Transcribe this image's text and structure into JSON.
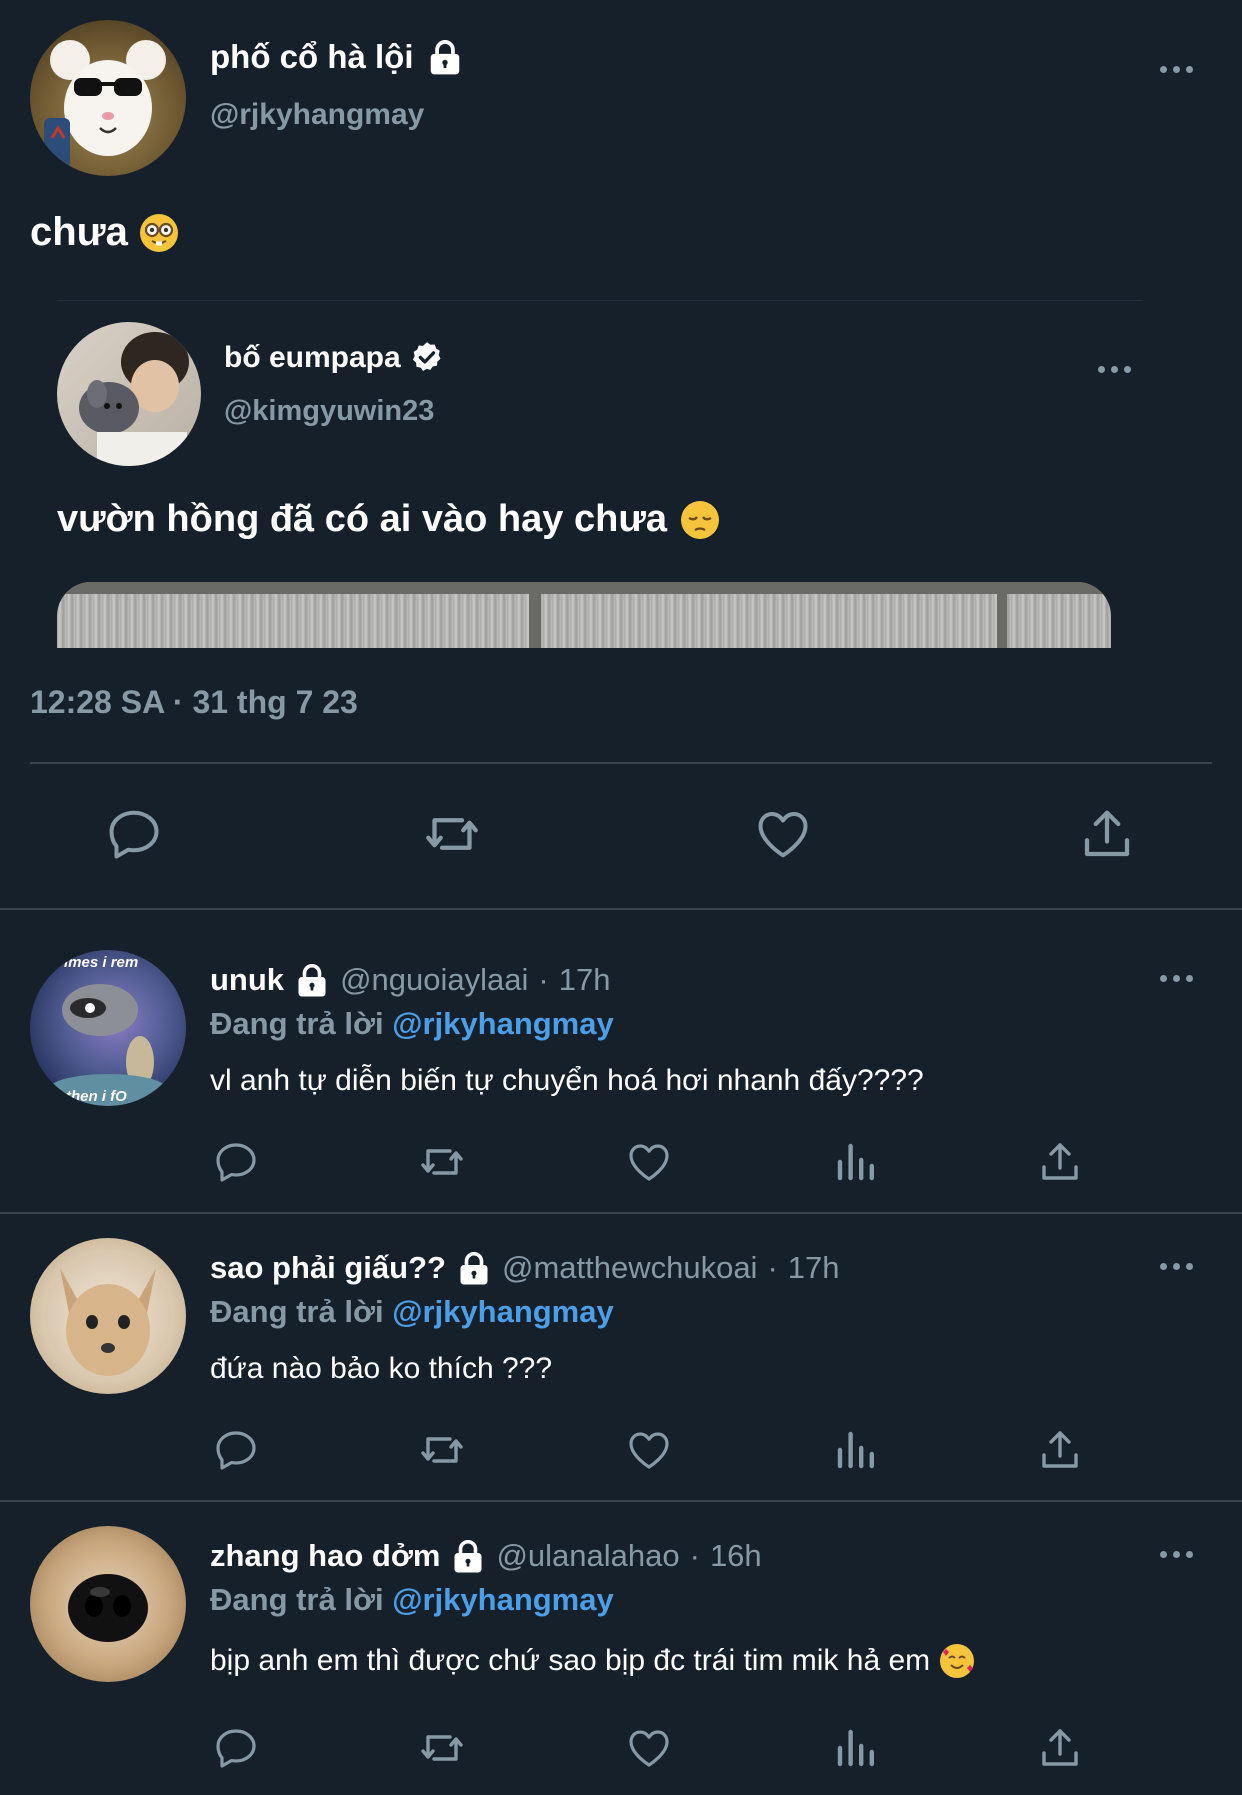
{
  "colors": {
    "background": "#15202b",
    "secondary_text": "#8899a6",
    "mention": "#4a9fe8",
    "divider": "#38444d"
  },
  "main_tweet": {
    "author_name": "phố cổ hà lội",
    "author_handle": "@rjkyhangmay",
    "text": "chưa",
    "timestamp": "12:28 SA · 31 thg 7 23",
    "icons": [
      "lock-icon",
      "more-icon",
      "nerd-face-emoji"
    ]
  },
  "quoted_tweet": {
    "author_name": "bố eumpapa",
    "author_handle": "@kimgyuwin23",
    "text": "vườn hồng đã có ai vào hay chưa",
    "icons": [
      "verified-icon",
      "pensive-face-emoji",
      "more-icon"
    ]
  },
  "main_actions": [
    "reply-icon",
    "retweet-icon",
    "like-icon",
    "share-icon"
  ],
  "replies": [
    {
      "name": "unuk",
      "handle": "@nguoiaylaai",
      "time": "17h",
      "replying_prefix": "Đang trả lời",
      "replying_to": "@rjkyhangmay",
      "text": "vl anh tự diễn biến tự chuyển hoá hơi nhanh đấy????",
      "avatar_text_top": "imes i rem",
      "avatar_text_bottom": "then i fO"
    },
    {
      "name": "sao phải giấu??",
      "handle": "@matthewchukoai",
      "time": "17h",
      "replying_prefix": "Đang trả lời",
      "replying_to": "@rjkyhangmay",
      "text": "đứa nào bảo ko thích ???"
    },
    {
      "name": "zhang hao dởm",
      "handle": "@ulanalahao",
      "time": "16h",
      "replying_prefix": "Đang trả lời",
      "replying_to": "@rjkyhangmay",
      "text": "bịp anh em thì được chứ sao bịp đc trái tim mik hả em",
      "trailing_emoji": "smiling-face-with-hearts-emoji"
    }
  ],
  "reply_actions": [
    "reply-icon",
    "retweet-icon",
    "like-icon",
    "views-icon",
    "share-icon"
  ]
}
